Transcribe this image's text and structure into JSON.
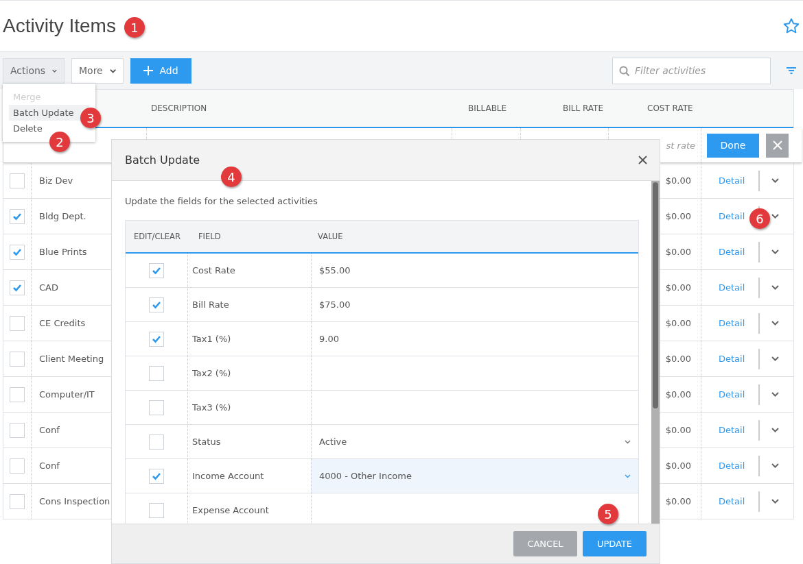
{
  "page": {
    "title": "Activity Items"
  },
  "toolbar": {
    "actions": "Actions",
    "more": "More",
    "add": "Add",
    "filter_placeholder": "Filter activities"
  },
  "actions_menu": [
    {
      "label": "Merge",
      "disabled": true,
      "selected": false
    },
    {
      "label": "Batch Update",
      "disabled": false,
      "selected": true
    },
    {
      "label": "Delete",
      "disabled": false,
      "selected": false
    }
  ],
  "table": {
    "columns": [
      "DESCRIPTION",
      "BILLABLE",
      "BILL RATE",
      "COST RATE"
    ],
    "edit_row": {
      "cost_rate_placeholder": "st rate",
      "done": "Done"
    },
    "rows": [
      {
        "name": "Biz Dev",
        "checked": false,
        "cost_rate": "$0.00",
        "detail": "Detail"
      },
      {
        "name": "Bldg Dept.",
        "checked": true,
        "cost_rate": "$0.00",
        "detail": "Detail"
      },
      {
        "name": "Blue Prints",
        "checked": true,
        "cost_rate": "$0.00",
        "detail": "Detail"
      },
      {
        "name": "CAD",
        "checked": true,
        "cost_rate": "$0.00",
        "detail": "Detail"
      },
      {
        "name": "CE Credits",
        "checked": false,
        "cost_rate": "$0.00",
        "detail": "Detail"
      },
      {
        "name": "Client Meeting",
        "checked": false,
        "cost_rate": "$0.00",
        "detail": "Detail"
      },
      {
        "name": "Computer/IT",
        "checked": false,
        "cost_rate": "$0.00",
        "detail": "Detail"
      },
      {
        "name": "Conf",
        "checked": false,
        "cost_rate": "$0.00",
        "detail": "Detail"
      },
      {
        "name": "Conf",
        "checked": false,
        "cost_rate": "$0.00",
        "detail": "Detail"
      },
      {
        "name": "Cons Inspection",
        "checked": false,
        "cost_rate": "$0.00",
        "detail": "Detail"
      }
    ]
  },
  "dialog": {
    "title": "Batch Update",
    "description": "Update the fields for the selected activities",
    "columns": [
      "EDIT/CLEAR",
      "FIELD",
      "VALUE"
    ],
    "rows": [
      {
        "field": "Cost Rate",
        "checked": true,
        "kind": "text",
        "value": "$55.00"
      },
      {
        "field": "Bill Rate",
        "checked": true,
        "kind": "text",
        "value": "$75.00"
      },
      {
        "field": "Tax1 (%)",
        "checked": true,
        "kind": "text",
        "value": "9.00"
      },
      {
        "field": "Tax2 (%)",
        "checked": false,
        "kind": "text"
      },
      {
        "field": "Tax3 (%)",
        "checked": false,
        "kind": "text"
      },
      {
        "field": "Status",
        "checked": false,
        "kind": "select",
        "value": "Active",
        "focused": false
      },
      {
        "field": "Income Account",
        "checked": true,
        "kind": "select",
        "value": "4000 - Other Income",
        "focused": true
      },
      {
        "field": "Expense Account",
        "checked": false,
        "kind": "text"
      }
    ],
    "cancel": "CANCEL",
    "update": "UPDATE"
  },
  "callouts": [
    "1",
    "2",
    "3",
    "4",
    "5",
    "6"
  ]
}
